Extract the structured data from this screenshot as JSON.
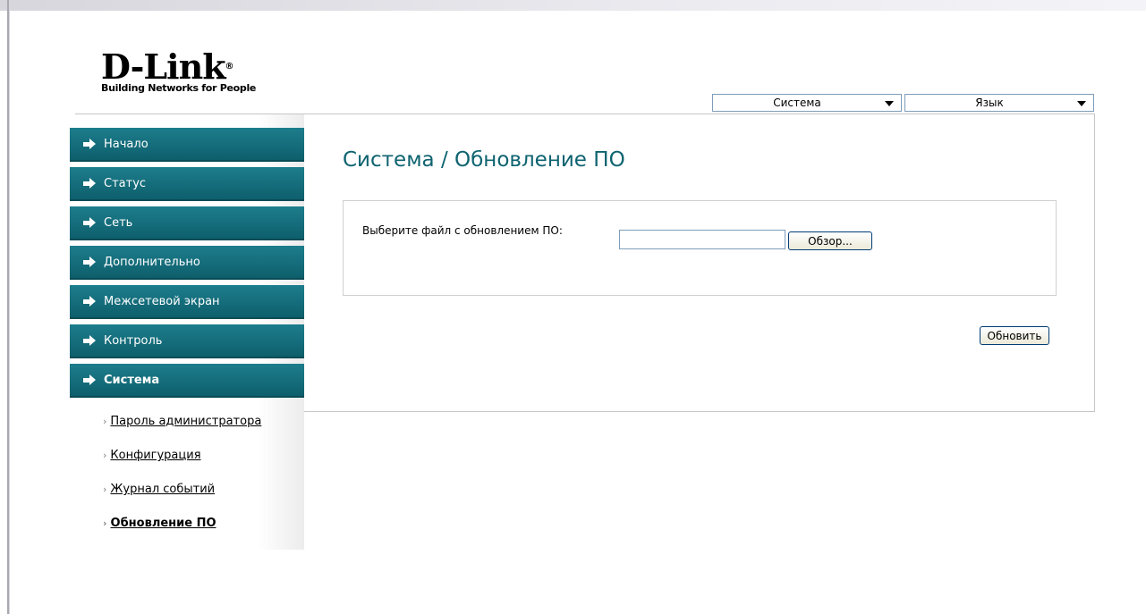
{
  "logo": {
    "brand": "D-Link",
    "reg_mark": "®",
    "tagline": "Building Networks for People"
  },
  "top_menu": {
    "system_label": "Система",
    "language_label": "Язык"
  },
  "sidebar": {
    "items": [
      {
        "label": "Начало"
      },
      {
        "label": "Статус"
      },
      {
        "label": "Сеть"
      },
      {
        "label": "Дополнительно"
      },
      {
        "label": "Межсетевой экран"
      },
      {
        "label": "Контроль"
      },
      {
        "label": "Система"
      }
    ],
    "active_item": "Система",
    "subitems": [
      {
        "label": "Пароль администратора"
      },
      {
        "label": "Конфигурация"
      },
      {
        "label": "Журнал событий"
      },
      {
        "label": "Обновление ПО"
      }
    ],
    "active_subitem": "Обновление ПО"
  },
  "main": {
    "title": "Система / Обновление ПО",
    "file_label": "Выберите файл с обновлением ПО:",
    "file_value": "",
    "browse_label": "Обзор...",
    "update_label": "Обновить"
  },
  "colors": {
    "nav_bg": "#0e5f6c",
    "title": "#0e6370",
    "input_border": "#7f9db9"
  }
}
